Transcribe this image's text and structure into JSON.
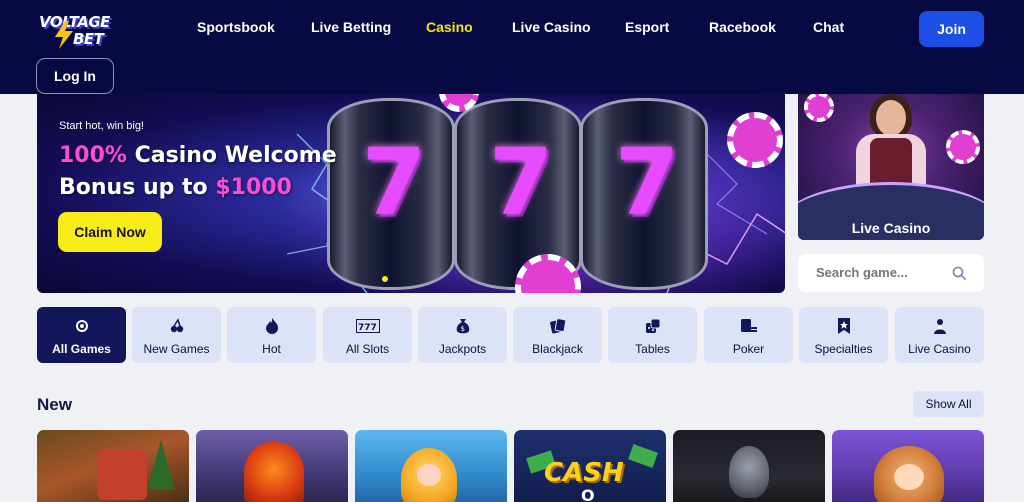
{
  "header": {
    "logo_line1": "VOLTAGE",
    "logo_line2": "BET",
    "nav": [
      {
        "label": "Sportsbook",
        "active": false
      },
      {
        "label": "Live Betting",
        "active": false
      },
      {
        "label": "Casino",
        "active": true
      },
      {
        "label": "Live Casino",
        "active": false
      },
      {
        "label": "Esport",
        "active": false
      },
      {
        "label": "Racebook",
        "active": false
      },
      {
        "label": "Chat",
        "active": false
      }
    ],
    "join_label": "Join",
    "login_label": "Log In"
  },
  "hero": {
    "tagline": "Start hot, win big!",
    "headline_highlight": "100%",
    "headline_part1": " Casino Welcome",
    "headline_part2": "Bonus up to ",
    "headline_amount": "$1000",
    "cta_label": "Claim Now",
    "reel_symbol": "7"
  },
  "live_card": {
    "label": "Live Casino"
  },
  "search": {
    "placeholder": "Search game..."
  },
  "categories": [
    {
      "label": "All Games",
      "icon": "sun-icon",
      "active": true
    },
    {
      "label": "New Games",
      "icon": "cherries-icon",
      "active": false
    },
    {
      "label": "Hot",
      "icon": "flame-icon",
      "active": false
    },
    {
      "label": "All Slots",
      "icon": "slot-777-icon",
      "active": false
    },
    {
      "label": "Jackpots",
      "icon": "money-bag-icon",
      "active": false
    },
    {
      "label": "Blackjack",
      "icon": "cards-icon",
      "active": false
    },
    {
      "label": "Tables",
      "icon": "dice-icon",
      "active": false
    },
    {
      "label": "Poker",
      "icon": "poker-chips-icon",
      "active": false
    },
    {
      "label": "Specialties",
      "icon": "star-badge-icon",
      "active": false
    },
    {
      "label": "Live Casino",
      "icon": "dealer-icon",
      "active": false
    }
  ],
  "new_section": {
    "title": "New",
    "show_all_label": "Show All",
    "games": [
      {
        "name": "game-thumbnail-1"
      },
      {
        "name": "game-thumbnail-2"
      },
      {
        "name": "game-thumbnail-3"
      },
      {
        "name": "game-thumbnail-cash",
        "title_text": "CASH",
        "sub_text": "O"
      },
      {
        "name": "game-thumbnail-5"
      },
      {
        "name": "game-thumbnail-6"
      }
    ]
  },
  "colors": {
    "header_bg": "#060942",
    "active_nav": "#f5e51d",
    "join_bg": "#1d4fe6",
    "claim_bg": "#f8ec18",
    "highlight_pink": "#ff4bd8",
    "category_active_bg": "#12175c",
    "category_bg": "#dde3f6"
  }
}
